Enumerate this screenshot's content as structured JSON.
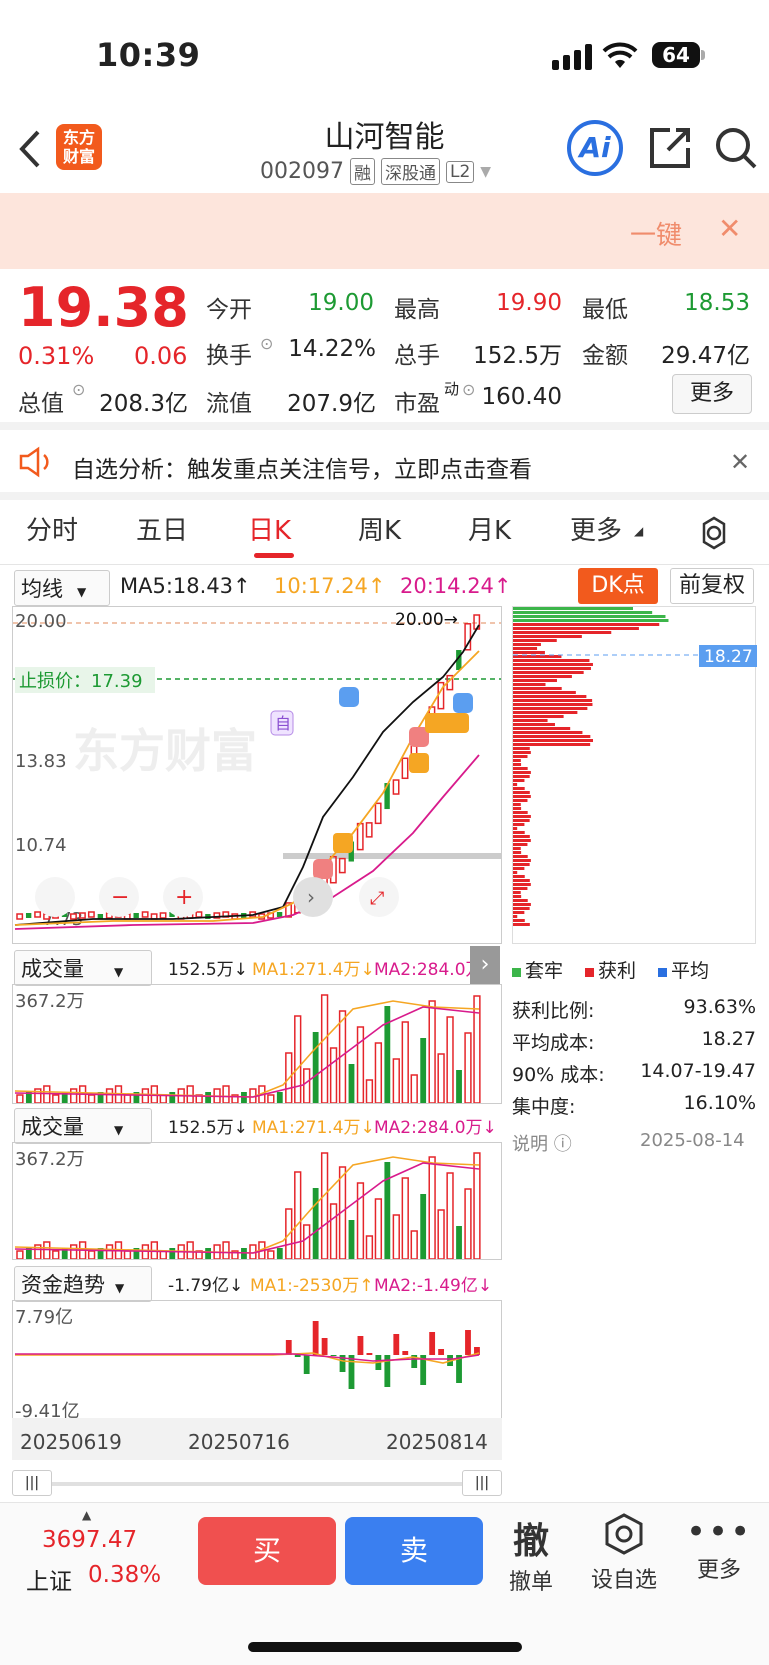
{
  "status": {
    "time": "10:39",
    "battery": "64"
  },
  "nav": {
    "logo_line1": "东方",
    "logo_line2": "财富",
    "title": "山河智能",
    "code": "002097",
    "tags": [
      "融",
      "深股通",
      "L2"
    ],
    "ai_label": "Ai"
  },
  "banner": {
    "text": "一键"
  },
  "quote": {
    "price": "19.38",
    "change_pct": "0.31%",
    "change": "0.06",
    "open_label": "今开",
    "open": "19.00",
    "high_label": "最高",
    "high": "19.90",
    "low_label": "最低",
    "low": "18.53",
    "turnover_label": "换手",
    "turnover": "14.22%",
    "volume_label": "总手",
    "volume": "152.5万",
    "amount_label": "金额",
    "amount": "29.47亿",
    "mktcap_label": "总值",
    "mktcap": "208.3亿",
    "float_label": "流值",
    "float": "207.9亿",
    "pe_label": "市盈",
    "pe_sup": "动",
    "pe": "160.40",
    "more": "更多"
  },
  "notice": {
    "text": "自选分析：触发重点关注信号，立即点击查看"
  },
  "tabs": [
    "分时",
    "五日",
    "日K",
    "周K",
    "月K",
    "更多"
  ],
  "active_tab": "日K",
  "kline": {
    "selector": "均线",
    "ma5": "MA5:18.43↑",
    "ma10": "10:17.24↑",
    "ma20": "20:14.24↑",
    "dk": "DK点",
    "adjust": "前复权",
    "y_top": "20.00",
    "y_mid": "13.83",
    "y_low": "10.74",
    "y_bottom": "7.73",
    "high_mark": "20.00→",
    "stop_loss": "止损价：17.39",
    "watermark": "东方财富",
    "marker_self": "自",
    "cost_tag": "18.27"
  },
  "vol1": {
    "selector": "成交量",
    "value": "152.5万↓",
    "ma1": "MA1:271.4万↓",
    "ma2": "MA2:284.0万↓",
    "ymax": "367.2万"
  },
  "vol2": {
    "selector": "成交量",
    "value": "152.5万↓",
    "ma1": "MA1:271.4万↓",
    "ma2": "MA2:284.0万↓",
    "ymax": "367.2万"
  },
  "fund": {
    "selector": "资金趋势",
    "value": "-1.79亿↓",
    "ma1": "MA1:-2530万↑",
    "ma2": "MA2:-1.49亿↓",
    "ymax": "7.79亿",
    "ymin": "-9.41亿"
  },
  "dates": [
    "20250619",
    "20250716",
    "20250814"
  ],
  "chips": {
    "legend": [
      "套牢",
      "获利",
      "平均"
    ],
    "rows": [
      {
        "label": "获利比例:",
        "value": "93.63%"
      },
      {
        "label": "平均成本:",
        "value": "18.27"
      },
      {
        "label": "90% 成本:",
        "value": "14.07-19.47"
      },
      {
        "label": "集中度:",
        "value": "16.10%"
      }
    ],
    "note": "说明",
    "date": "2025-08-14"
  },
  "bottom": {
    "index_value": "3697.47",
    "index_name": "上证",
    "index_pct": "0.38%",
    "buy": "买",
    "sell": "卖",
    "cancel_icon": "撤",
    "cancel": "撤单",
    "watch": "设自选",
    "more": "更多"
  },
  "colors": {
    "up": "#e5252a",
    "down": "#1d9a33",
    "accent": "#f25a1d",
    "blue": "#2a6fe0"
  }
}
